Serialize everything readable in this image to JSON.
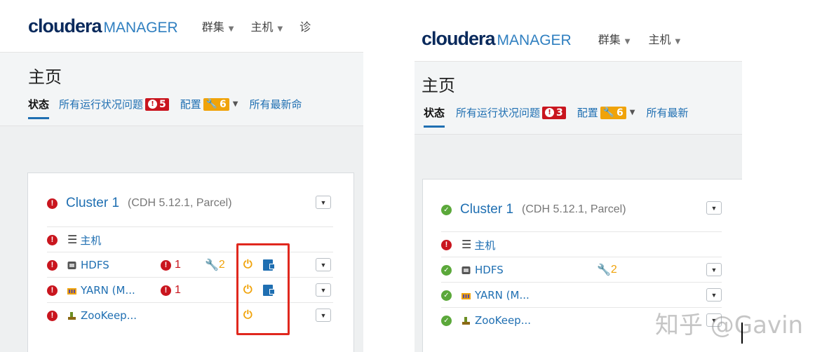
{
  "left": {
    "logo": {
      "brand": "cloudera",
      "product": "MANAGER"
    },
    "nav": [
      {
        "label": "群集"
      },
      {
        "label": "主机"
      },
      {
        "label": "诊"
      }
    ],
    "page_title": "主页",
    "tabs": {
      "status": "状态",
      "health_issues": "所有运行状况问题",
      "health_count": "5",
      "config": "配置",
      "config_count": "6",
      "recent": "所有最新命"
    },
    "cluster": {
      "status": "error",
      "name": "Cluster 1",
      "version": "(CDH 5.12.1, Parcel)",
      "services": [
        {
          "name": "主机",
          "status": "error",
          "icon": "list-icon",
          "alerts": "",
          "config": "",
          "restart": false,
          "stale_config": false,
          "menu": false
        },
        {
          "name": "HDFS",
          "status": "error",
          "icon": "hdfs-icon",
          "alerts": "1",
          "config": "2",
          "restart": true,
          "stale_config": true,
          "menu": true
        },
        {
          "name": "YARN (M...",
          "status": "error",
          "icon": "yarn-icon",
          "alerts": "1",
          "config": "",
          "restart": true,
          "stale_config": true,
          "menu": true
        },
        {
          "name": "ZooKeep...",
          "status": "error",
          "icon": "zookeeper-icon",
          "alerts": "",
          "config": "",
          "restart": true,
          "stale_config": false,
          "menu": true
        }
      ]
    },
    "highlight_color": "#e0281e"
  },
  "right": {
    "logo": {
      "brand": "cloudera",
      "product": "MANAGER"
    },
    "nav": [
      {
        "label": "群集"
      },
      {
        "label": "主机"
      }
    ],
    "page_title": "主页",
    "tabs": {
      "status": "状态",
      "health_issues": "所有运行状况问题",
      "health_count": "3",
      "config": "配置",
      "config_count": "6",
      "recent": "所有最新"
    },
    "cluster": {
      "status": "ok",
      "name": "Cluster 1",
      "version": "(CDH 5.12.1, Parcel)",
      "services": [
        {
          "name": "主机",
          "status": "error",
          "icon": "list-icon",
          "config": "",
          "menu": false
        },
        {
          "name": "HDFS",
          "status": "ok",
          "icon": "hdfs-icon",
          "config": "2",
          "menu": true
        },
        {
          "name": "YARN (M...",
          "status": "ok",
          "icon": "yarn-icon",
          "config": "",
          "menu": true
        },
        {
          "name": "ZooKeep...",
          "status": "ok",
          "icon": "zookeeper-icon",
          "config": "",
          "menu": true
        }
      ]
    }
  },
  "watermark": "知乎 @Gavin",
  "colors": {
    "error": "#c9151e",
    "ok": "#5ba83a",
    "warning": "#f0a30a",
    "link": "#1f6fb2",
    "brand": "#0a2a5c"
  }
}
